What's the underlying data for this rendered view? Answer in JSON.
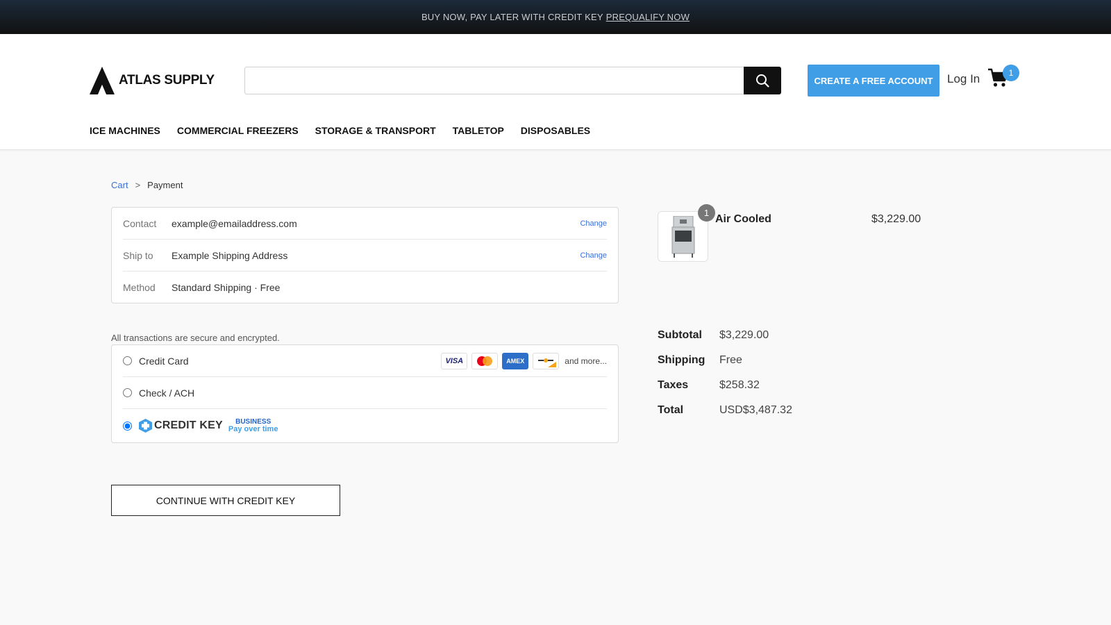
{
  "promo": {
    "text": "BUY NOW, PAY LATER WITH CREDIT KEY",
    "link": "PREQUALIFY NOW"
  },
  "header": {
    "logo_text": "ATLAS SUPPLY",
    "search_placeholder": "",
    "create_account": "CREATE A FREE ACCOUNT",
    "login": "Log In",
    "cart_count": "1"
  },
  "nav": [
    "ICE MACHINES",
    "COMMERCIAL FREEZERS",
    "STORAGE & TRANSPORT",
    "TABLETOP",
    "DISPOSABLES"
  ],
  "breadcrumb": {
    "cart": "Cart",
    "sep": ">",
    "current": "Payment"
  },
  "info": {
    "contact_label": "Contact",
    "contact_value": "example@emailaddress.com",
    "change1": "Change",
    "ship_label": "Ship to",
    "ship_value": "Example Shipping Address",
    "change2": "Change",
    "method_label": "Method",
    "method_value": "Standard Shipping · Free"
  },
  "secure_note": "All transactions are secure and encrypted.",
  "payment": {
    "credit_card": "Credit Card",
    "visa": "VISA",
    "amex": "AMEX",
    "more": "and more...",
    "check": "Check / ACH",
    "credit_key": "CREDIT KEY",
    "business": "BUSINESS",
    "pay_over_time": "Pay over time",
    "selected": "credit_key"
  },
  "continue_button": "CONTINUE WITH CREDIT KEY",
  "order": {
    "qty": "1",
    "product_name": "Air Cooled",
    "product_price": "$3,229.00",
    "subtotal_label": "Subtotal",
    "subtotal": "$3,229.00",
    "shipping_label": "Shipping",
    "shipping": "Free",
    "taxes_label": "Taxes",
    "taxes": "$258.32",
    "total_label": "Total",
    "total": "USD$3,487.32"
  },
  "colors": {
    "accent": "#3f9ee6",
    "link": "#3a6fd8",
    "promo_bg": "#1c2a3a"
  }
}
